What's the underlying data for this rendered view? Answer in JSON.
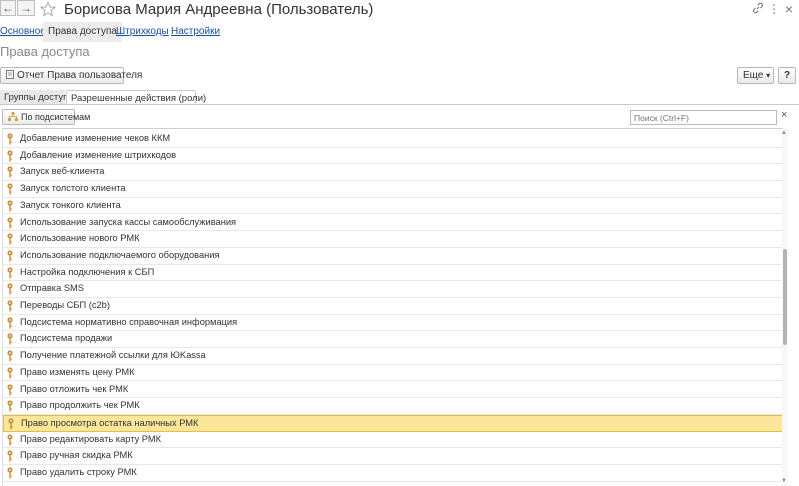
{
  "window": {
    "title": "Борисова Мария Андреевна (Пользователь)",
    "back_glyph": "←",
    "forward_glyph": "→",
    "link_icon_glyph": "🔗",
    "more_icon_glyph": "⋮",
    "close_glyph": "×"
  },
  "top_tabs": [
    {
      "label": "Основное",
      "active": false
    },
    {
      "label": "Права доступа",
      "active": true
    },
    {
      "label": "Штрихкоды",
      "active": false
    },
    {
      "label": "Настройки",
      "active": false
    }
  ],
  "section_title": "Права доступа",
  "command_bar": {
    "report_button": "Отчет Права пользователя",
    "more_button": "Еще",
    "more_arrow": "▾",
    "help_button": "?"
  },
  "inner_tabs": [
    {
      "label": "Группы доступа",
      "active": false
    },
    {
      "label": "Разрешенные действия (роли)",
      "active": true
    }
  ],
  "toolbar": {
    "by_subsystems_button": "По подсистемам"
  },
  "search": {
    "placeholder": "Поиск (Ctrl+F)",
    "clear_glyph": "×"
  },
  "roles": [
    {
      "label": "Добавление изменение чеков ККМ"
    },
    {
      "label": "Добавление изменение штрихкодов"
    },
    {
      "label": "Запуск веб-клиента"
    },
    {
      "label": "Запуск толстого клиента"
    },
    {
      "label": "Запуск тонкого клиента"
    },
    {
      "label": "Использование запуска кассы самообслуживания"
    },
    {
      "label": "Использование нового РМК"
    },
    {
      "label": "Использование подключаемого оборудования"
    },
    {
      "label": "Настройка подключения к СБП"
    },
    {
      "label": "Отправка SMS"
    },
    {
      "label": "Переводы СБП (c2b)"
    },
    {
      "label": "Подсистема нормативно справочная информация"
    },
    {
      "label": "Подсистема продажи"
    },
    {
      "label": "Получение платежной ссылки для ЮKassa"
    },
    {
      "label": "Право изменять цену РМК"
    },
    {
      "label": "Право отложить чек РМК"
    },
    {
      "label": "Право продолжить чек РМК"
    },
    {
      "label": "Право просмотра остатка наличных РМК",
      "selected": true
    },
    {
      "label": "Право редактировать карту РМК"
    },
    {
      "label": "Право ручная скидка РМК"
    },
    {
      "label": "Право удалить строку РМК"
    }
  ],
  "colors": {
    "link": "#1a4f9c",
    "selected_row": "#fbe69a",
    "key_icon": "#c4913c"
  }
}
